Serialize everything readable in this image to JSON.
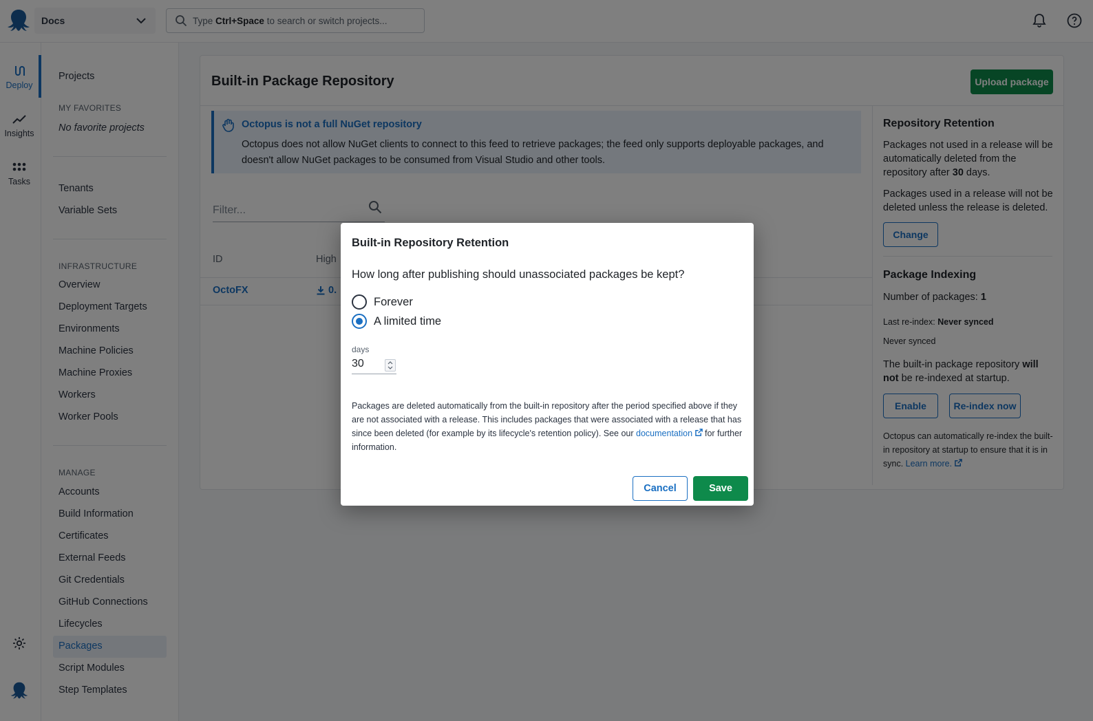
{
  "topbar": {
    "space": "Docs",
    "search_pre": "Type ",
    "search_shortcut": "Ctrl+Space",
    "search_post": " to search or switch projects..."
  },
  "rail": {
    "items": [
      {
        "label": "Deploy",
        "icon": "deploy-icon"
      },
      {
        "label": "Insights",
        "icon": "insights-icon"
      },
      {
        "label": "Tasks",
        "icon": "tasks-icon"
      }
    ]
  },
  "sidebar": {
    "projects": "Projects",
    "favorites_heading": "MY FAVORITES",
    "favorites_empty": "No favorite projects",
    "tenants": "Tenants",
    "variable_sets": "Variable Sets",
    "infrastructure_heading": "INFRASTRUCTURE",
    "infrastructure": [
      "Overview",
      "Deployment Targets",
      "Environments",
      "Machine Policies",
      "Machine Proxies",
      "Workers",
      "Worker Pools"
    ],
    "manage_heading": "MANAGE",
    "manage": [
      "Accounts",
      "Build Information",
      "Certificates",
      "External Feeds",
      "Git Credentials",
      "GitHub Connections",
      "Lifecycles",
      "Packages",
      "Script Modules",
      "Step Templates"
    ]
  },
  "main": {
    "title": "Built-in Package Repository",
    "upload": "Upload package",
    "callout_title": "Octopus is not a full NuGet repository",
    "callout_body": "Octopus does not allow NuGet clients to connect to this feed to retrieve packages; the feed only supports deployable packages, and doesn't allow NuGet packages to be consumed from Visual Studio and other tools.",
    "filter_placeholder": "Filter...",
    "col_id": "ID",
    "col_highest": "High",
    "row_id": "OctoFX",
    "row_version": "0."
  },
  "retention": {
    "title": "Repository Retention",
    "p1_pre": "Packages not used in a release will be automatically deleted from the repository after ",
    "p1_days": "30",
    "p1_post": " days.",
    "p2": "Packages used in a release will not be deleted unless the release is deleted.",
    "change": "Change"
  },
  "indexing": {
    "title": "Package Indexing",
    "count_label": "Number of packages: ",
    "count": "1",
    "last_label": "Last re-index: ",
    "last_value": "Never synced",
    "status": "Never synced",
    "startup_pre": "The built-in package repository ",
    "startup_bold": "will not",
    "startup_post": " be re-indexed at startup.",
    "enable": "Enable",
    "reindex": "Re-index now",
    "note": "Octopus can automatically re-index the built-in repository at startup to ensure that it is in sync. ",
    "learn_more": "Learn more."
  },
  "dialog": {
    "title": "Built-in Repository Retention",
    "question": "How long after publishing should unassociated packages be kept?",
    "option_forever": "Forever",
    "option_limited": "A limited time",
    "selected": "A limited time",
    "days_label": "days",
    "days_value": "30",
    "note_pre": "Packages are deleted automatically from the built-in repository after the period specified above if they are not associated with a release. This includes packages that were associated with a release that has since been deleted (for example by its lifecycle's retention policy). See our ",
    "note_link": "documentation",
    "note_post": " for further information.",
    "cancel": "Cancel",
    "save": "Save"
  },
  "colors": {
    "accent": "#1a6fc2",
    "primary_button": "#0e8a4b"
  }
}
